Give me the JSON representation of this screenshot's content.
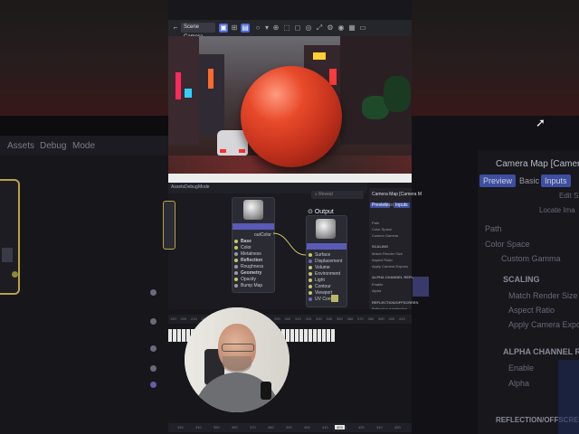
{
  "background": {
    "menu": [
      "Assets",
      "Debug",
      "Mode"
    ],
    "panel": {
      "title": "Camera Map [Camera M",
      "tabs": [
        "Preview",
        "Basic",
        "Inputs"
      ],
      "labels": [
        "Path",
        "Color Space",
        "Custom Gamma"
      ],
      "sections": [
        "SCALING",
        "ALPHA CHANNEL REPL",
        "REFLECTION/OFFSCREEN"
      ],
      "scaling_items": [
        "Match Render Size",
        "Aspect Ratio",
        "Apply Camera Exposu"
      ],
      "alpha_items": [
        "Enable",
        "Alpha"
      ],
      "right_items": [
        "Edit Sh",
        "Locate Ima"
      ]
    }
  },
  "toolbar": {
    "camera_select": "Scene Camera"
  },
  "node_editor": {
    "menu": [
      "Assets",
      "Debug",
      "Mode"
    ],
    "search_placeholder": "Reveal",
    "material_node": {
      "out_label": "outColor",
      "pins": [
        "Base",
        "Color",
        "Metalness",
        "Reflection",
        "Roughness",
        "Geometry",
        "Opacity",
        "Bump Map"
      ]
    },
    "output_node": {
      "title": "Output",
      "pins": [
        "Surface",
        "Displacement",
        "Volume",
        "Environment",
        "Light",
        "Contour",
        "Viewport",
        "UV Context"
      ]
    },
    "properties": {
      "title": "Camera Map [Camera M",
      "tabs": [
        "Preview",
        "Basic",
        "Inputs"
      ],
      "items": [
        "Path",
        "Color Space",
        "Custom Gamma",
        "SCALING",
        "Match Render Size",
        "Aspect Ratio",
        "Apply Camera Exposu",
        "ALPHA CHANNEL REPL",
        "Enable",
        "Alpha",
        "REFLECTION/OFFSCREEN",
        "Reflection is/reflection"
      ]
    }
  },
  "timeline": {
    "ruler": [
      "190",
      "200",
      "210",
      "220",
      "230",
      "240",
      "250",
      "260",
      "270",
      "280",
      "290",
      "300",
      "310",
      "320",
      "330",
      "340",
      "350",
      "360",
      "370",
      "380",
      "390",
      "400",
      "410"
    ],
    "bottom": [
      "330",
      "340",
      "350",
      "360",
      "370",
      "380",
      "390",
      "400",
      "410",
      "420",
      "430",
      "440",
      "450"
    ],
    "current_frame": "403"
  },
  "colors": {
    "accent": "#4b6bd6",
    "sphere": "#d4402a",
    "node_header": "#5a5ab8"
  }
}
